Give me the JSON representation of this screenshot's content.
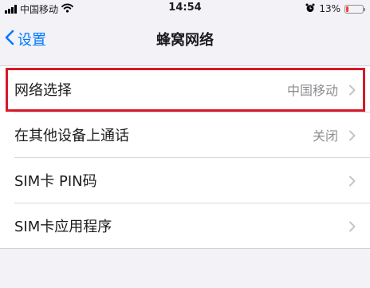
{
  "status_bar": {
    "carrier": "中国移动",
    "time": "14:54",
    "battery_percent": "13%",
    "battery_level": 0.13,
    "icons": [
      "signal-icon",
      "wifi-icon",
      "alarm-icon",
      "battery-icon"
    ]
  },
  "nav": {
    "back_label": "设置",
    "title": "蜂窝网络"
  },
  "rows": [
    {
      "label": "网络选择",
      "detail": "中国移动"
    },
    {
      "label": "在其他设备上通话",
      "detail": "关闭"
    },
    {
      "label": "SIM卡 PIN码",
      "detail": ""
    },
    {
      "label": "SIM卡应用程序",
      "detail": ""
    }
  ],
  "colors": {
    "accent": "#007aff",
    "highlight": "#d7192a",
    "background": "#f2f2f7",
    "battery_low": "#ff3b30"
  }
}
